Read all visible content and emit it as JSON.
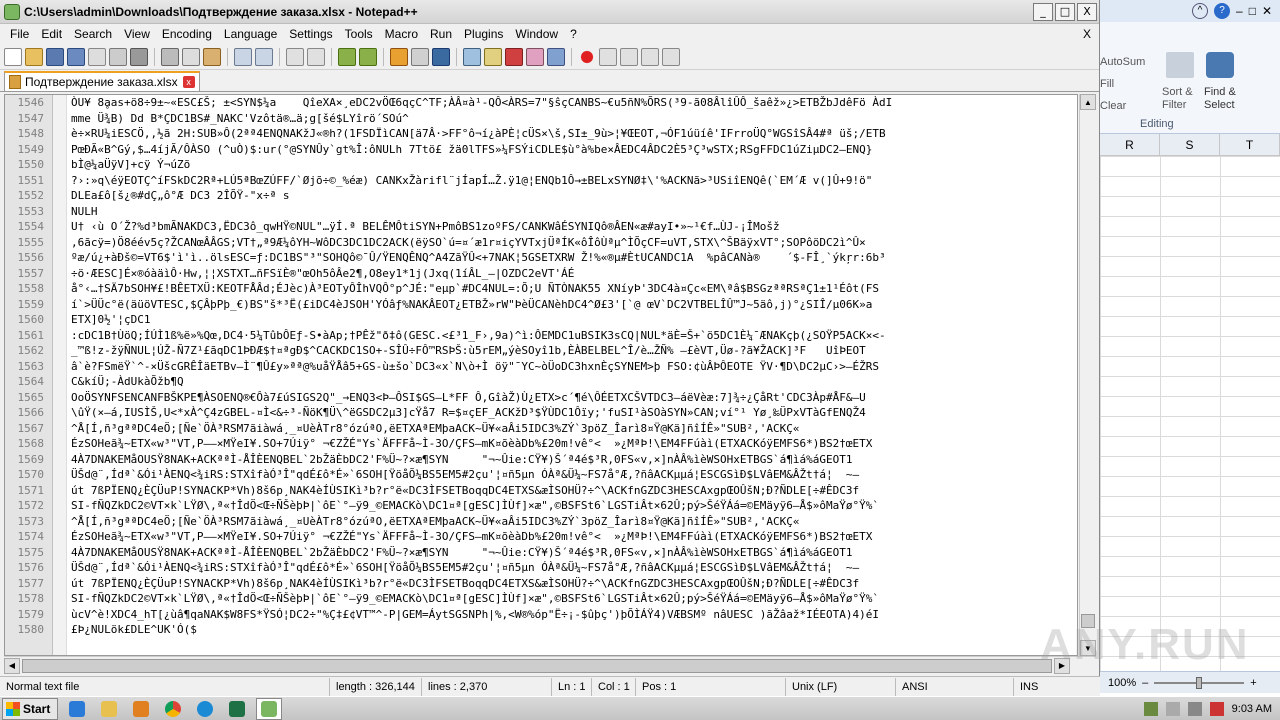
{
  "window": {
    "title": "C:\\Users\\admin\\Downloads\\Подтверждение заказа.xlsx - Notepad++",
    "minimize": "_",
    "maximize": "□",
    "close": "X"
  },
  "menu": [
    "File",
    "Edit",
    "Search",
    "View",
    "Encoding",
    "Language",
    "Settings",
    "Tools",
    "Macro",
    "Run",
    "Plugins",
    "Window",
    "?"
  ],
  "menu_close": "X",
  "tab": {
    "label": "Подтверждение заказа.xlsx",
    "close": "x"
  },
  "editor": {
    "line_numbers": [
      "1546",
      "1547",
      "1548",
      "1549",
      "1550",
      "1551",
      "1552",
      "1553",
      "1554",
      "1555",
      "1556",
      "1557",
      "1558",
      "1559",
      "1560",
      "1561",
      "1562",
      "1563",
      "1564",
      "1565",
      "1566",
      "1567",
      "1568",
      "1569",
      "1570",
      "1571",
      "1572",
      "1573",
      "1574",
      "1575",
      "1576",
      "1577",
      "1578",
      "1579",
      "1580"
    ],
    "lines": [
      "ÒU¥ 8ḁas+ö8÷9±~«ESC£Š; ±<SYN$¼a    QîeXA×¸eDC2vÖŒ6qçC^TF;ÀÂ¤à¹-QÔ<ÀRS=7\"§ŝçCANBS~€u5ñN%ÕRS(³9-ã08ÂlîÛÔ_šaêž»¿>ETBŽbJdêFö ÀdI",
      "mme Ü¾B) Dd B*ÇDC1BS#_NAKC'Vzôtä®…ä;g[šé$LYîrö´SOú^",
      "è÷×RU¼iESCÖ,,½ã 2H:SUB»Ô(2ªª4ENQNAKžJ«®h?(1FSDÏìCAN[ä7Â·>FF°ô¬í¿àPÈ¦cÜS×\\š,SI±_9ù>¦¥ŒEOT,¬ÓF1úüíê'IFrroÜQ°WGSîSÂ4#ª üš;/ETB",
      "PœÐÃ«B^Gý,$…4íjÃ/ÔÀSO (^uÒ)$:ur(°@SYNÛy`gt%Î:ôNULh 7Ttö£ žä0lTFS»¼FSÝiCDLE$ù°à%be×ÂEDC4ÂDC2È5³Ç³wSTX;RSgFFDC1úZiµDC2—ENQ}",
      "bÌ@¼aÜÿV]+cÿ Ý¬úZõ",
      "?›:»q\\éÿEOTÇ^íFSkDC2Rª+LÚ5ªBœZÚFF/`Øjõ÷©_%éæ) CANKxŽàrifl¨jÍapÍ…Ž.ÿ1@¦ENQb1Ô→±BELxSYNØ‡\\'%ACKNã>³USiîENQê(`EM´Æ v(]Û+9!ö\"",
      "DLEa£ô[š¿®#dÇ„ô°Æ DC3 2ÎÕŸ-\"x÷ª s",
      "NULH",
      "U† ‹ù O´Ž?%d³bmÃNAKDC3,ËDC3ô_qwHŸ©NUL\"…ÿÍ.ª BELÊMÔtiSYN+PmôBS1zoºFS/CANKWâÉSYNIQô®ÂEN«æ#ayI•»~¹€f…ÙJ-¡ÎMošž",
      ",6ãcÿ=)Ö8éév5ç?ŽCANœÂÂGS;VT†„ª9Æ¼ôYH~WôDC3DC1DC2ACK(ëÿSO`ú=¤´æ1r¤içYVTxjÜªÍK«ôÎôÙªµ^ÌÕçCF=uVT,STX\\^ŠBäÿxVT°;SOPôöDC2ì^Û×",
      "ºæ/ú¿+àÐš©=VT6$'ì'ì..ölsESC=ƒ:DC1BS\"³\"SOHQô©¯Û/ŸENQÊNQ^A4ZãŸÛ<+7NAK¦5GSETXRW Ž!%«®µ#ÈtUCANDC1A  %pâCANà®    ´$-FÎ¸`ýkŗr:6b³",
      "÷ö·ÆESC]É×®óàäìÔ·Hw,¦¦XSTXT…ñFSïÈ®\"œOh5ôÂe2¶,O8ey1*1j(Jxq(1íÂL_—|OZDC2eVT'ÁÉ",
      "å°‹…†SÄ7bSOH¥£!BÊETXÜ:KEOTFÅÂd;ÉJèc)À³EOTyÔÎhVQÔ°p^JÉ:\"eµp`#DC4NUL=:Õ;U ÑTÒNAK55 XNíyÞ'3DC4à¤Çc«EM\\ªâ$BSGzªªRSªÇ1±1¹Éôt(FS",
      "í`>ÜÜc°ë(äüöVTESC,$ÇÂþPþ_€)BS\"š*³Ë(£iDC4èJSOH'YÓâƒ%NAKÂEOT¿ETBŽ»rW\"ÞèÜCANèhDC4^Ø£3'[`@ œV`DC2VTBELÎÛ™J~5äô,j)°¿SIÎ/µ06K»a",
      "ETX]0½'¦çDC1",
      ":cDC1B†ÙöQ;ÍÚÌ1ß%ë»%Qœ,DC4·5¼TûbÔEƒ-S•àAp;†PÊž\"ð‡ô(GESC.<£³1_F›,9a)^ì:ÔEMDC1uBSIK3sCQ|NUL*äÈ=Š+`ö5DC1È¼¯ÆNAKçþ(¿SOŸP5ACK×<-",
      "_™ß!z-žÿÑNUL¦ÚŽ-Ñ7Z¹£ãqDC1ÞÐÆ$†¤ªgÐ$^CACKDC1SO+-SÎÛ÷FÔ™RSÞŠ:ù5rEM„ýèSOyî1b,ÈÀBELBEL^Î/è…ŽÑ% —£èVT,Üø-?ã¥ŽACK]³F   UîÞEOT",
      "â`è?FSmëŸ`^-×ÜšcGRÊÎäETBv—Ì¨¶Û£y»ªª@%uåŸÅâ5+GS-ù±šo`DC3«x`N\\ò+Ì öÿ\"¯YC~òÜoDC3hxnÈçSYNEM>þ FSO:¢ùÂÞÔEOTE ŸV·¶D\\DC2µC›>—ÉŽRS",
      "C&kíÜ;-ÀdUkàÕžb¶Q",
      "OoÖSYNFSENCANFBŠKPE¶ÀSOENQ®€Ôà7£úSIGS2Q\"_→ENQ3<Þ—ÔSI$GS—L*FF Ô,GîàŽ)Ù¿ETX>c´¶é\\ÔÉETXCŠVTDC3—áëVèæ:7]¾÷¿ÇåRt'CDC3Àp#ÅF&—U",
      "\\ûŸ(×—á,IUSÌŠ,U<*xÀ^Ç4zGBEL-¤Ì<&÷³-ÑöK¶Ü\\^ëGSDC2µ3]cŸå7 R=$¤çEF_ACKžD³$ŸÙDC1Ôïy;'fuSI¹àSOàSYN»CAN;ví°¹ Yø¸‰ÜPxVTàGfENQŽ4",
      "^Å[Í,ñ³gªªDC4eÖ;[Ñe`ÖÀ³RSM7ãiàwá¸_¤UèÀTr8°ózúªO,ëETXAªEMþaACK~Ü¥«aÂi5IDC3%ZÝ`3pöZ_Îarì8¤Ÿ@Kä]ñîÍÊ»\"SUB²,'ACKÇ«",
      "ÉzSOHeã¾~ETX«w³\"VT,P——×MŸeI¥.SO+7Úiÿ° ¬€ZŽÉ\"Ys`ÄFFFå~Ì-3O/ÇFS—mK¤õèàDb%£20m!vê°<  »¿MªÞ!\\EM4FFúàì(ETXACKóÿEMFS6*)BS2†œETX",
      "4À7DNAKEMåOUSŸ8NAK+ACKªªÌ-ÅÎÈENQBEL`2bŽäÈbDC2'F%Ü~?×æ¶SYN     \"¬~Ûie:CŸ¥)Š´ª4é$³R,0FS«v,×]nÀÂ%ìèWSOHxETBGS`á¶ìá%áGEOT1",
      "ÜŠd@¨,Ídª`&Ói¹ÀENQ<¾iRS:STXîfàÓ³Î\"qdÉ£ô*É»`6SOH[ŸöåÕ¼BS5EM5#2çu'¦¤ñ5µn ÓÀª&Ü¼~FS7å°Æ,?ñâACKµµá¦ESCGSìÐ$LVâEM&ÂŽt†á¦  ~—",
      "út 7ßPÏENQ¿ÈÇÜuP!SYNACKP*Vh)8š6p¸NAK4èÍÙSIKì³b?r°ë«DC3ÌFSETBoqqDC4ETXS&æÌSOHÜ?÷^\\ACKfnGZDC3HESCAxgpŒOÛšN;Ð?ÑDLE[÷#ÊDC3f",
      "SI-fÑQZkDC2©VT×k`LŸØ\\,ª«†ÎdÖ<Œ÷ÑŠèþÞ|`ôE`°—ÿ9_©EMACKò\\DC1¤ª[gESC]ÌÙf]×æ\",©BSFSt6`LGSTiÂt×62Û;pý>ŠéŸÁá=©EMäyÿ6—Å$»ôMaŸø°Ÿ%`",
      "^Å[Í,ñ³gªªDC4eÖ;[Ñe`ÖÀ³RSM7ãiàwá¸_¤UèÀTr8°ózúªO,ëETXAªEMþaACK~Ü¥«aÂi5IDC3%ZÝ`3pöZ_Îarì8¤Ÿ@Kä]ñîÍÊ»\"SUB²,'ACKÇ«",
      "ÉzSOHeã¾~ETX«w³\"VT,P——×MŸeI¥.SO+7Úiÿ° ¬€ZŽÉ\"Ys`ÄFFFå~Ì-3O/ÇFS—mK¤õèàDb%£20m!vê°<  »¿MªÞ!\\EM4FFúàì(ETXACKóÿEMFS6*)BS2†œETX",
      "4À7DNAKEMåOUSŸ8NAK+ACKªªÌ-ÅÎÈENQBEL`2bŽäÈbDC2'F%Ü~?×æ¶SYN     \"¬~Ûie:CŸ¥)Š´ª4é$³R,0FS«v,×]nÀÂ%ìèWSOHxETBGS`á¶ìá%áGEOT1",
      "ÜŠd@¨,Ídª`&Ói¹ÀENQ<¾iRS:STXîfàÓ³Î\"qdÉ£ô*É»`6SOH[ŸöåÕ¼BS5EM5#2çu'¦¤ñ5µn ÓÀª&Ü¼~FS7å°Æ,?ñâACKµµá¦ESCGSìÐ$LVâEM&ÂŽt†á¦  ~—",
      "út 7ßPÏENQ¿ÈÇÜuP!SYNACKP*Vh)8š6p¸NAK4èÍÙSIKì³b?r°ë«DC3ÌFSETBoqqDC4ETXS&æÌSOHÜ?÷^\\ACKfnGZDC3HESCAxgpŒOÛšN;Ð?ÑDLE[÷#ÊDC3f",
      "SI-fÑQZkDC2©VT×k`LŸØ\\,ª«†ÎdÖ<Œ÷ÑŠèþÞ|`ôE`°—ÿ9_©EMACKò\\DC1¤ª[gESC]ÌÙf]×æ\",©BSFSt6`LGSTiÂt×62Û;pý>ŠéŸÁá=©EMäyÿ6—Å$»ôMaŸø°Ÿ%`",
      "ùcV^è!XDC4_hT[¿ùâ¶qaNAK$W8FS*ŸSÓ¦DC2÷\"%Ç‡£¢VT™^-P|GEM=ÁytSGSNPh|%,<W®%óp\"Ë÷¡-$ûþç')þÕÌÁŸ4)VÆBSMº nâUESC )ãŽâaž*IÉEOTA)4)éI",
      "£Þ¿NULök£DLE^UK'Ó($"
    ]
  },
  "status": {
    "file_type": "Normal text file",
    "length": "length : 326,144",
    "lines": "lines : 2,370",
    "ln": "Ln : 1",
    "col": "Col : 1",
    "pos": "Pos : 1",
    "eol": "Unix (LF)",
    "encoding": "ANSI",
    "mode": "INS"
  },
  "excel": {
    "autosum": "AutoSum",
    "fill": "Fill",
    "clear": "Clear",
    "sort_filter": "Sort &\nFilter",
    "find_select": "Find &\nSelect",
    "group": "Editing",
    "columns": [
      "R",
      "S",
      "T"
    ],
    "zoom": "100%"
  },
  "taskbar": {
    "start": "Start",
    "clock": "9:03 AM"
  },
  "watermark": "ANY.RUN"
}
